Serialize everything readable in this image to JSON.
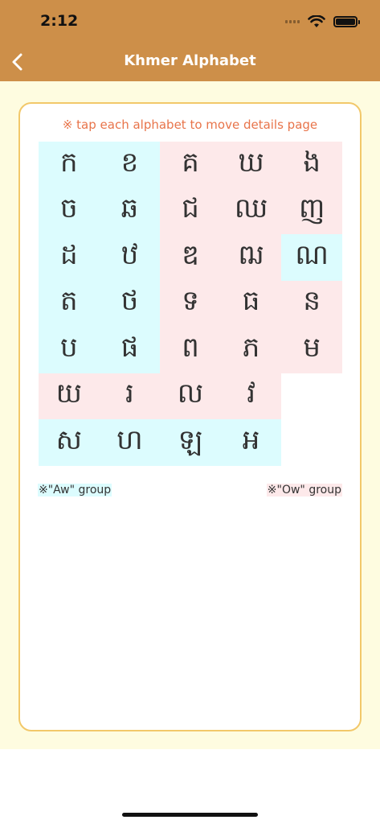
{
  "status_bar": {
    "time": "2:12"
  },
  "nav": {
    "title": "Khmer Alphabet"
  },
  "hint": "※ tap each alphabet to move details page",
  "legend": {
    "aw": "※\"Aw\" group",
    "ow": "※\"Ow\" group"
  },
  "colors": {
    "header": "#cd8f49",
    "background": "#fefce0",
    "card_border": "#f2c86a",
    "hint": "#e8744a",
    "aw_group": "#dcfcfe",
    "ow_group": "#fde9ea"
  },
  "letters": [
    {
      "char": "ក",
      "group": "aw"
    },
    {
      "char": "ខ",
      "group": "aw"
    },
    {
      "char": "គ",
      "group": "ow"
    },
    {
      "char": "ឃ",
      "group": "ow"
    },
    {
      "char": "ង",
      "group": "ow"
    },
    {
      "char": "ច",
      "group": "aw"
    },
    {
      "char": "ឆ",
      "group": "aw"
    },
    {
      "char": "ជ",
      "group": "ow"
    },
    {
      "char": "ឈ",
      "group": "ow"
    },
    {
      "char": "ញ",
      "group": "ow"
    },
    {
      "char": "ដ",
      "group": "aw"
    },
    {
      "char": "ឋ",
      "group": "aw"
    },
    {
      "char": "ឌ",
      "group": "ow"
    },
    {
      "char": "ឍ",
      "group": "ow"
    },
    {
      "char": "ណ",
      "group": "aw"
    },
    {
      "char": "ត",
      "group": "aw"
    },
    {
      "char": "ថ",
      "group": "aw"
    },
    {
      "char": "ទ",
      "group": "ow"
    },
    {
      "char": "ធ",
      "group": "ow"
    },
    {
      "char": "ន",
      "group": "ow"
    },
    {
      "char": "ប",
      "group": "aw"
    },
    {
      "char": "ផ",
      "group": "aw"
    },
    {
      "char": "ព",
      "group": "ow"
    },
    {
      "char": "ភ",
      "group": "ow"
    },
    {
      "char": "ម",
      "group": "ow"
    },
    {
      "char": "យ",
      "group": "ow"
    },
    {
      "char": "រ",
      "group": "ow"
    },
    {
      "char": "ល",
      "group": "ow"
    },
    {
      "char": "វ",
      "group": "ow"
    },
    {
      "char": "ស",
      "group": "aw"
    },
    {
      "char": "ហ",
      "group": "aw"
    },
    {
      "char": "ឡ",
      "group": "aw"
    },
    {
      "char": "អ",
      "group": "aw"
    }
  ]
}
